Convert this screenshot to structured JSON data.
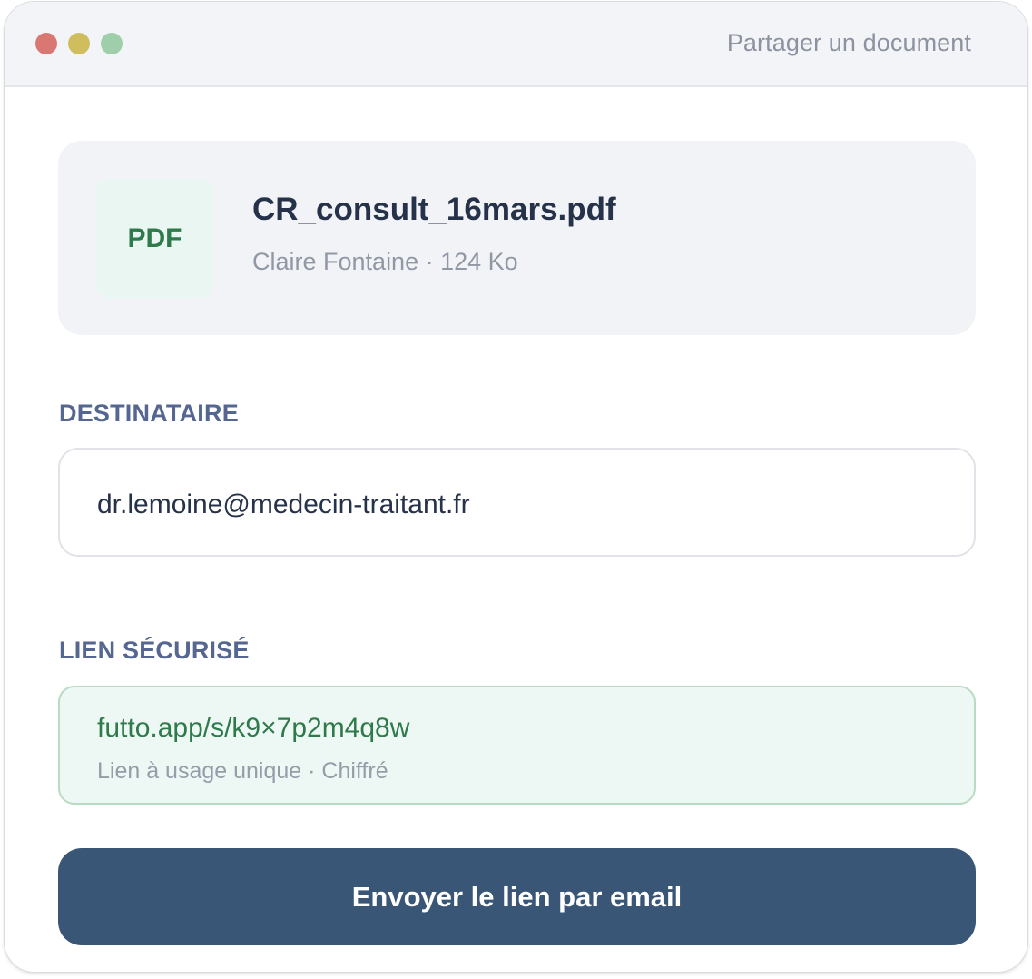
{
  "window": {
    "title": "Partager un document",
    "controls": [
      "close",
      "minimize",
      "maximize"
    ]
  },
  "file": {
    "badge": "PDF",
    "name": "CR_consult_16mars.pdf",
    "meta": "Claire Fontaine · 124 Ko"
  },
  "recipient": {
    "label": "DESTINATAIRE",
    "value": "dr.lemoine@medecin-traitant.fr"
  },
  "secure_link": {
    "label": "LIEN SÉCURISÉ",
    "url": "futto.app/s/k9×7p2m4q8w",
    "meta": "Lien à usage unique · Chiffré"
  },
  "actions": {
    "send_label": "Envoyer le lien par email"
  },
  "colors": {
    "accent": "#395677",
    "success": "#2f7a4b",
    "label": "#556791",
    "text": "#26314a"
  }
}
